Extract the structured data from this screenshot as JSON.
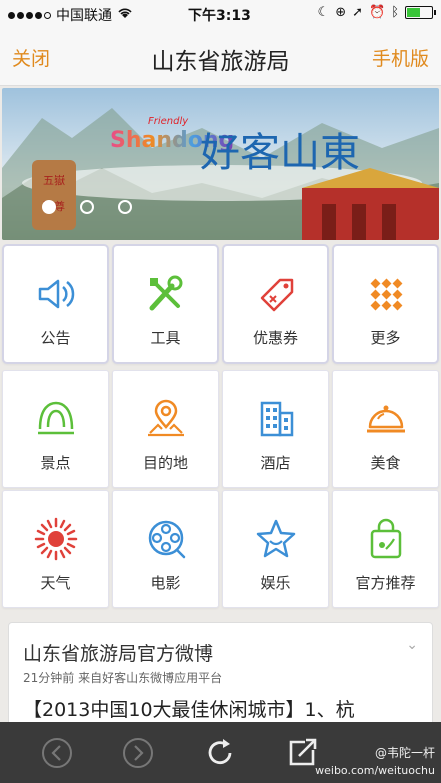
{
  "status_bar": {
    "carrier": "中国联通",
    "time": "下午3:13"
  },
  "nav": {
    "close": "关闭",
    "title": "山东省旅游局",
    "mobile_version": "手机版"
  },
  "banner": {
    "friendly": "Friendly",
    "logo": "Shandong",
    "slogan": "好客山東"
  },
  "tiles_top": [
    {
      "label": "公告",
      "icon": "speaker-icon"
    },
    {
      "label": "工具",
      "icon": "tools-icon"
    },
    {
      "label": "优惠券",
      "icon": "coupon-icon"
    },
    {
      "label": "更多",
      "icon": "grid-dots-icon"
    }
  ],
  "tiles_row1": [
    {
      "label": "景点",
      "icon": "scenic-icon"
    },
    {
      "label": "目的地",
      "icon": "location-icon"
    },
    {
      "label": "酒店",
      "icon": "hotel-icon"
    },
    {
      "label": "美食",
      "icon": "food-cloche-icon"
    }
  ],
  "tiles_row2": [
    {
      "label": "天气",
      "icon": "sun-icon"
    },
    {
      "label": "电影",
      "icon": "film-reel-icon"
    },
    {
      "label": "娱乐",
      "icon": "star-icon"
    },
    {
      "label": "官方推荐",
      "icon": "shopping-bag-icon"
    }
  ],
  "weibo": {
    "title": "山东省旅游局官方微博",
    "meta": "21分钟前  来自好客山东微博应用平台",
    "post": "【2013中国10大最佳休闲城市】1、杭"
  },
  "watermark": {
    "line1": "@韦陀一杆",
    "line2": "weibo.com/weituochu"
  },
  "colors": {
    "accent": "#e08a1e",
    "green": "#5cbf3a",
    "blue": "#3c8fd6",
    "red": "#e0413a",
    "orange": "#f08a24"
  }
}
